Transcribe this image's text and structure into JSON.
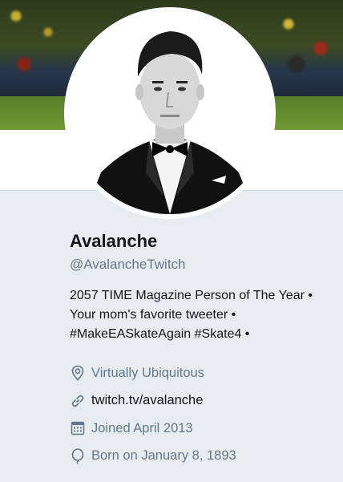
{
  "profile": {
    "name": "Avalanche",
    "handle": "@AvalancheTwitch",
    "bio_lines": [
      "2057 TIME Magazine Person of The Year •",
      "Your mom's favorite tweeter •",
      "#MakeEASkateAgain #Skate4 •"
    ],
    "location": "Virtually Ubiquitous",
    "website": "twitch.tv/avalanche",
    "joined": "Joined April 2013",
    "born": "Born on January 8, 1893"
  },
  "icons": {
    "location": "location-pin-icon",
    "website": "link-icon",
    "joined": "calendar-icon",
    "born": "balloon-icon"
  },
  "colors": {
    "background": "#e6ecf0",
    "text": "#14171a",
    "muted": "#657786"
  }
}
